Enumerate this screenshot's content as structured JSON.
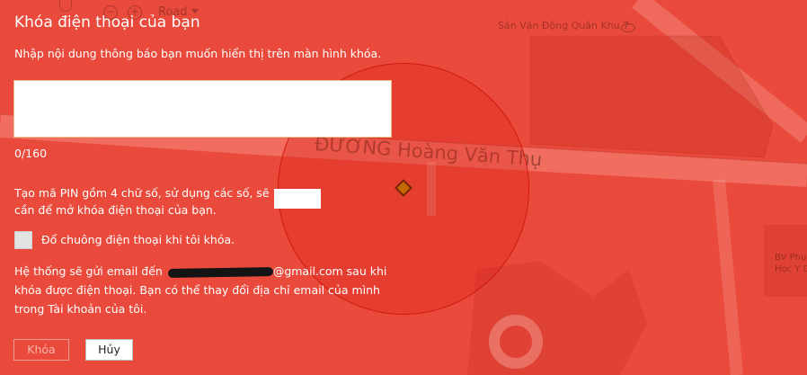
{
  "map": {
    "road_type": "Road",
    "labels": {
      "stadium": "Sân Vận Động Quân Khu 7",
      "street": "ĐƯỜNG Hoàng Văn Thụ",
      "hospital": "BV Phụ Học Y D"
    },
    "icons": {
      "zoom_out": "−",
      "zoom_in": "+"
    }
  },
  "dialog": {
    "title": "Khóa điện thoại của bạn",
    "instructions": "Nhập nội dung thông báo bạn muốn hiển thị trên màn hình khóa.",
    "message_value": "",
    "char_counter": "0/160",
    "pin_description": "Tạo mã PIN gồm 4 chữ số, sử dụng các số, sẽ cần để mở khóa điện thoại của bạn.",
    "pin_value": "",
    "ring_label": "Đổ chuông điện thoại khi tôi khóa.",
    "email_prefix": "Hệ thống sẽ gửi email đến ",
    "email_suffix": "@gmail.com sau khi khóa được điện thoại. Bạn có thể thay đổi địa chỉ email của mình trong Tài khoản của tôi.",
    "buttons": {
      "lock": "Khóa",
      "cancel": "Hủy"
    }
  },
  "colors": {
    "overlay": "#ea4a3b",
    "radius_circle": "#d01a10",
    "pin_marker": "#c46a00"
  }
}
